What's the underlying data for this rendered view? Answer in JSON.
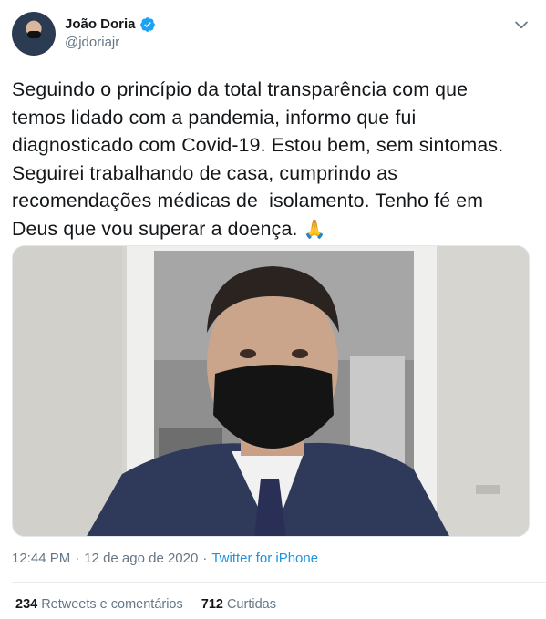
{
  "author": {
    "name": "João Doria",
    "handle": "@jdoriajr",
    "verified": true,
    "avatar_icon": "profile-photo"
  },
  "tweet": {
    "text": "Seguindo o princípio da total transparência com que\ntemos lidado com a pandemia, informo que fui\ndiagnosticado com Covid-19. Estou bem, sem sintomas.\nSeguirei trabalhando de casa, cumprindo as\nrecomendações médicas de  isolamento. Tenho fé em\nDeus que vou superar a doença.",
    "emoji": "🙏",
    "media_icon": "video-thumbnail"
  },
  "meta": {
    "time": "12:44 PM",
    "separator": "·",
    "date": "12 de ago de 2020",
    "source": "Twitter for iPhone"
  },
  "stats": {
    "retweets_count": "234",
    "retweets_label": "Retweets e comentários",
    "likes_count": "712",
    "likes_label": "Curtidas"
  },
  "colors": {
    "text": "#14171a",
    "secondary": "#657786",
    "link": "#1b95e0",
    "verified": "#1da1f2"
  }
}
